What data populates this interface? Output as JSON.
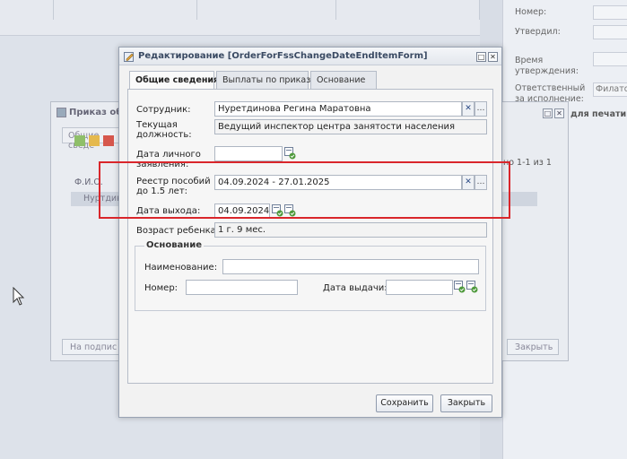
{
  "background": {
    "right_panel": {
      "fields": [
        {
          "label": "Номер:",
          "value": ""
        },
        {
          "label": "Утвердил:",
          "value": ""
        },
        {
          "label": "Время утверждения:",
          "value": ""
        },
        {
          "label": "Ответственный за исполнение:",
          "value": "Филатов"
        }
      ],
      "print_label": "для печати"
    },
    "order_dialog": {
      "title": "Приказ об о",
      "tab": "Общие сведе",
      "pager": "но 1-1 из 1",
      "column_fio": "Ф.И.О.",
      "row_text": "Нуртдин",
      "sign_button": "На подпис",
      "close_button": "Закрыть"
    }
  },
  "dialog": {
    "title": "Редактирование [OrderForFssChangeDateEndItemForm]",
    "tabs": [
      {
        "label": "Общие сведения",
        "active": true
      },
      {
        "label": "Выплаты по приказу",
        "active": false
      },
      {
        "label": "Основание",
        "active": false
      }
    ],
    "form": {
      "employee_label": "Сотрудник:",
      "employee_value": "Нуретдинова Регина Маратовна",
      "position_label": "Текущая должность:",
      "position_value": "Ведущий инспектор центра занятости населения",
      "app_date_label": "Дата личного заявления:",
      "app_date_value": "",
      "registry_label": "Реестр пособий до 1.5 лет:",
      "registry_value": "04.09.2024 - 27.01.2025",
      "exit_date_label": "Дата выхода:",
      "exit_date_value": "04.09.2024",
      "child_age_label": "Возраст ребенка:",
      "child_age_value": "1 г. 9 мес."
    },
    "basis": {
      "legend": "Основание",
      "name_label": "Наименование:",
      "name_value": "",
      "number_label": "Номер:",
      "number_value": "",
      "issue_date_label": "Дата выдачи:",
      "issue_date_value": ""
    },
    "buttons": {
      "save": "Сохранить",
      "close": "Закрыть"
    }
  },
  "colors": {
    "highlight": "#d9262b",
    "dialog_title": "#3a4a63"
  }
}
